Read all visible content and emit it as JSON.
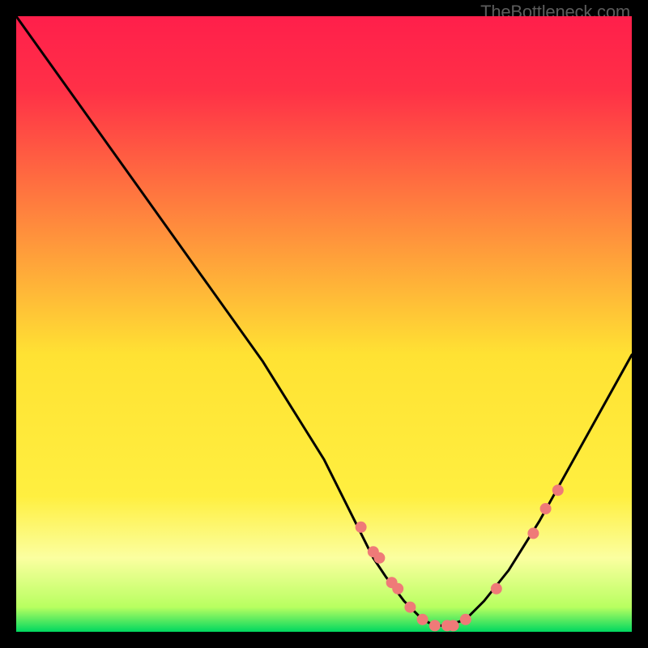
{
  "watermark": "TheBottleneck.com",
  "chart_data": {
    "type": "line",
    "title": "",
    "xlabel": "",
    "ylabel": "",
    "xlim": [
      0,
      100
    ],
    "ylim": [
      0,
      100
    ],
    "background_gradient": {
      "top": "#ff1f4b",
      "mid": "#ffe233",
      "bottom": "#00d860"
    },
    "green_band_y": [
      0,
      5
    ],
    "pale_yellow_band_y": [
      5,
      15
    ],
    "curve": {
      "description": "V-shaped bottleneck curve; y is mismatch percentage, minimum near x≈68",
      "x": [
        0,
        5,
        10,
        15,
        20,
        25,
        30,
        35,
        40,
        45,
        50,
        55,
        58,
        60,
        63,
        66,
        68,
        70,
        73,
        76,
        80,
        85,
        90,
        95,
        100
      ],
      "y": [
        100,
        93,
        86,
        79,
        72,
        65,
        58,
        51,
        44,
        36,
        28,
        18,
        12,
        9,
        5,
        2,
        1,
        1,
        2,
        5,
        10,
        18,
        27,
        36,
        45
      ]
    },
    "markers": {
      "description": "salmon dots on the curve (sample/reference points)",
      "color": "#ef7a78",
      "points_x": [
        56,
        58,
        59,
        61,
        62,
        64,
        66,
        68,
        70,
        71,
        73,
        78,
        84,
        86,
        88
      ],
      "points_y": [
        17,
        13,
        12,
        8,
        7,
        4,
        2,
        1,
        1,
        1,
        2,
        7,
        16,
        20,
        23
      ]
    }
  }
}
